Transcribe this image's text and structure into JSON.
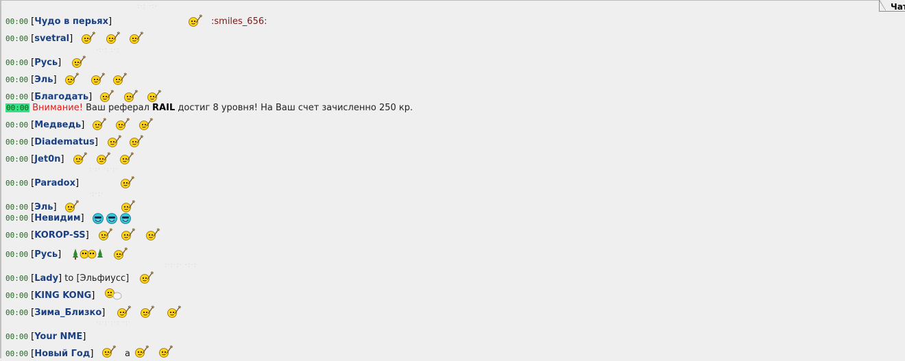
{
  "tab": {
    "label": "Чат"
  },
  "chat": {
    "rows": [
      {
        "time": "00:00",
        "nick": "Чудо в перьях",
        "text": "",
        "code": ":smiles_656:",
        "icon": "walking-cane-smiley-icon"
      },
      {
        "time": "00:00",
        "nick": "svetral",
        "text": "",
        "icon": "walking-cane-smiley-icon"
      },
      {
        "time": "00:00",
        "nick": "Русь",
        "text": "",
        "icon": "walking-cane-smiley-icon"
      },
      {
        "time": "00:00",
        "nick": "Эль",
        "text": "",
        "icon": "walking-cane-smiley-icon"
      },
      {
        "time": "00:00",
        "nick": "Благодать",
        "text": "",
        "icon": "walking-cane-smiley-icon"
      },
      {
        "time": "00:00",
        "system": true,
        "warn": "Внимание!",
        "pre": "Ваш реферал",
        "bold": "RAIL",
        "post": "достиг 8 уровня! На Ваш счет зачисленно 250 кр."
      },
      {
        "time": "00:00",
        "nick": "Медведь",
        "text": "",
        "icon": "walking-cane-smiley-icon"
      },
      {
        "time": "00:00",
        "nick": "Diadematus",
        "text": "",
        "icon": "walking-cane-smiley-icon"
      },
      {
        "time": "00:00",
        "nick": "Jet0n",
        "text": "",
        "icon": "walking-cane-smiley-icon"
      },
      {
        "time": "00:00",
        "nick": "Paradox",
        "text": "",
        "icon": "walking-cane-smiley-icon"
      },
      {
        "time": "00:00",
        "nick": "Эль",
        "text": "",
        "icon": "walking-cane-smiley-icon"
      },
      {
        "time": "00:00",
        "nick": "Невидим",
        "text": "",
        "icon": "cyan-grin-smiley-icon"
      },
      {
        "time": "00:00",
        "nick": "KOROP-SS",
        "text": "",
        "icon": "walking-cane-smiley-icon"
      },
      {
        "time": "00:00",
        "nick": "Русь",
        "text": "",
        "icon": "tree-smiley-icon"
      },
      {
        "time": "00:00",
        "nick": "Lady",
        "text": "to",
        "target": "[Эльфиусс]",
        "icon": "walking-cane-smiley-icon"
      },
      {
        "time": "00:00",
        "nick": "KING KONG",
        "text": "",
        "icon": "thinking-smiley-icon"
      },
      {
        "time": "00:00",
        "nick": "Зима_Близко",
        "text": "",
        "icon": "walking-cane-smiley-icon"
      },
      {
        "time": "00:00",
        "nick": "Your NME",
        "text": ""
      },
      {
        "time": "00:00",
        "nick": "Новый Год",
        "text": "a",
        "icon": "walking-cane-smiley-icon"
      }
    ]
  },
  "colors": {
    "nick": "#1a3f82",
    "time": "#1a6b1a",
    "warning": "#d91a1a",
    "time_highlight": "#33e08a",
    "background": "#efefef"
  }
}
